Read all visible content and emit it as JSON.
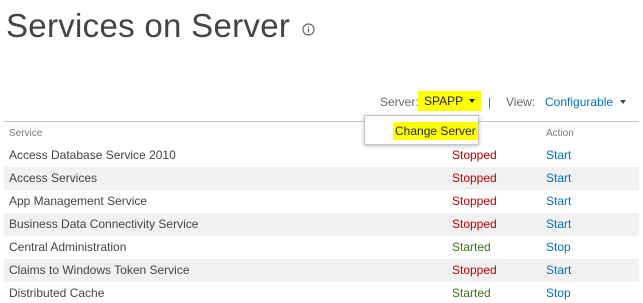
{
  "page": {
    "title": "Services on Server",
    "info_icon": "info-icon"
  },
  "toolbar": {
    "server_label": "Server:",
    "server_value": "SPAPP",
    "separator": "|",
    "view_label": "View:",
    "view_value": "Configurable"
  },
  "dropdown": {
    "items": [
      "Change Server"
    ]
  },
  "table": {
    "headers": [
      "Service",
      "Action"
    ],
    "rows": [
      {
        "name": "Access Database Service 2010",
        "status": "Stopped",
        "action": "Start"
      },
      {
        "name": "Access Services",
        "status": "Stopped",
        "action": "Start"
      },
      {
        "name": "App Management Service",
        "status": "Stopped",
        "action": "Start"
      },
      {
        "name": "Business Data Connectivity Service",
        "status": "Stopped",
        "action": "Start"
      },
      {
        "name": "Central Administration",
        "status": "Started",
        "action": "Stop"
      },
      {
        "name": "Claims to Windows Token Service",
        "status": "Stopped",
        "action": "Start"
      },
      {
        "name": "Distributed Cache",
        "status": "Started",
        "action": "Stop"
      }
    ]
  },
  "colors": {
    "highlight": "#ffff00",
    "link": "#0072c6",
    "stopped": "#c00000",
    "started": "#38761d"
  }
}
